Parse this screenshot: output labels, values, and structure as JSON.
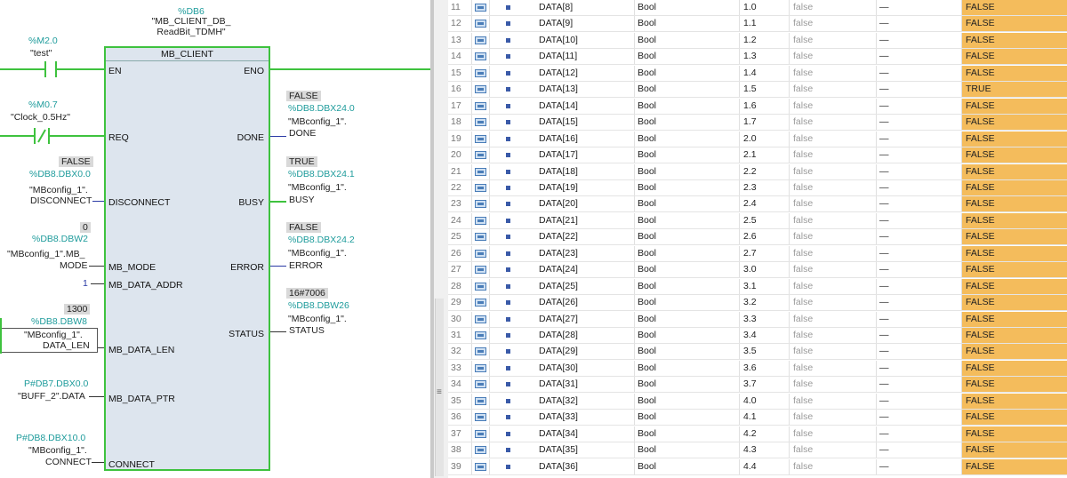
{
  "fb": {
    "instance_addr": "%DB6",
    "instance_name_1": "\"MB_CLIENT_DB_",
    "instance_name_2": "ReadBit_TDMH\"",
    "title": "MB_CLIENT",
    "pin_en": "EN",
    "pin_eno": "ENO",
    "pin_req": "REQ",
    "pin_disconnect": "DISCONNECT",
    "pin_mb_mode": "MB_MODE",
    "pin_mb_data_addr": "MB_DATA_ADDR",
    "pin_mb_data_len": "MB_DATA_LEN",
    "pin_mb_data_ptr": "MB_DATA_PTR",
    "pin_connect": "CONNECT",
    "pin_done": "DONE",
    "pin_busy": "BUSY",
    "pin_error": "ERROR",
    "pin_status": "STATUS"
  },
  "inputs": {
    "en_addr": "%M2.0",
    "en_tag": "\"test\"",
    "req_addr": "%M0.7",
    "req_tag": "\"Clock_0.5Hz\"",
    "disc_val": "FALSE",
    "disc_addr": "%DB8.DBX0.0",
    "disc_tag_1": "\"MBconfig_1\".",
    "disc_tag_2": "DISCONNECT",
    "mode_val": "0",
    "mode_addr": "%DB8.DBW2",
    "mode_tag_1": "\"MBconfig_1\".MB_",
    "mode_tag_2": "MODE",
    "addr_val": "1",
    "len_val": "1300",
    "len_addr": "%DB8.DBW8",
    "len_tag_1": "\"MBconfig_1\".",
    "len_tag_2": "DATA_LEN",
    "ptr_addr": "P#DB7.DBX0.0",
    "ptr_tag": "\"BUFF_2\".DATA",
    "conn_addr": "P#DB8.DBX10.0",
    "conn_tag_1": "\"MBconfig_1\".",
    "conn_tag_2": "CONNECT"
  },
  "outputs": {
    "done_val": "FALSE",
    "done_addr": "%DB8.DBX24.0",
    "done_tag_1": "\"MBconfig_1\".",
    "done_tag_2": "DONE",
    "busy_val": "TRUE",
    "busy_addr": "%DB8.DBX24.1",
    "busy_tag_1": "\"MBconfig_1\".",
    "busy_tag_2": "BUSY",
    "error_val": "FALSE",
    "error_addr": "%DB8.DBX24.2",
    "error_tag_1": "\"MBconfig_1\".",
    "error_tag_2": "ERROR",
    "status_val": "16#7006",
    "status_addr": "%DB8.DBW26",
    "status_tag_1": "\"MBconfig_1\".",
    "status_tag_2": "STATUS"
  },
  "table": {
    "rows": [
      {
        "num": "11",
        "name": "DATA[8]",
        "type": "Bool",
        "offset": "1.0",
        "start": "false",
        "retain": "—",
        "monitor": "FALSE"
      },
      {
        "num": "12",
        "name": "DATA[9]",
        "type": "Bool",
        "offset": "1.1",
        "start": "false",
        "retain": "—",
        "monitor": "FALSE"
      },
      {
        "num": "13",
        "name": "DATA[10]",
        "type": "Bool",
        "offset": "1.2",
        "start": "false",
        "retain": "—",
        "monitor": "FALSE"
      },
      {
        "num": "14",
        "name": "DATA[11]",
        "type": "Bool",
        "offset": "1.3",
        "start": "false",
        "retain": "—",
        "monitor": "FALSE"
      },
      {
        "num": "15",
        "name": "DATA[12]",
        "type": "Bool",
        "offset": "1.4",
        "start": "false",
        "retain": "—",
        "monitor": "FALSE"
      },
      {
        "num": "16",
        "name": "DATA[13]",
        "type": "Bool",
        "offset": "1.5",
        "start": "false",
        "retain": "—",
        "monitor": "TRUE"
      },
      {
        "num": "17",
        "name": "DATA[14]",
        "type": "Bool",
        "offset": "1.6",
        "start": "false",
        "retain": "—",
        "monitor": "FALSE"
      },
      {
        "num": "18",
        "name": "DATA[15]",
        "type": "Bool",
        "offset": "1.7",
        "start": "false",
        "retain": "—",
        "monitor": "FALSE"
      },
      {
        "num": "19",
        "name": "DATA[16]",
        "type": "Bool",
        "offset": "2.0",
        "start": "false",
        "retain": "—",
        "monitor": "FALSE"
      },
      {
        "num": "20",
        "name": "DATA[17]",
        "type": "Bool",
        "offset": "2.1",
        "start": "false",
        "retain": "—",
        "monitor": "FALSE"
      },
      {
        "num": "21",
        "name": "DATA[18]",
        "type": "Bool",
        "offset": "2.2",
        "start": "false",
        "retain": "—",
        "monitor": "FALSE"
      },
      {
        "num": "22",
        "name": "DATA[19]",
        "type": "Bool",
        "offset": "2.3",
        "start": "false",
        "retain": "—",
        "monitor": "FALSE"
      },
      {
        "num": "23",
        "name": "DATA[20]",
        "type": "Bool",
        "offset": "2.4",
        "start": "false",
        "retain": "—",
        "monitor": "FALSE"
      },
      {
        "num": "24",
        "name": "DATA[21]",
        "type": "Bool",
        "offset": "2.5",
        "start": "false",
        "retain": "—",
        "monitor": "FALSE"
      },
      {
        "num": "25",
        "name": "DATA[22]",
        "type": "Bool",
        "offset": "2.6",
        "start": "false",
        "retain": "—",
        "monitor": "FALSE"
      },
      {
        "num": "26",
        "name": "DATA[23]",
        "type": "Bool",
        "offset": "2.7",
        "start": "false",
        "retain": "—",
        "monitor": "FALSE"
      },
      {
        "num": "27",
        "name": "DATA[24]",
        "type": "Bool",
        "offset": "3.0",
        "start": "false",
        "retain": "—",
        "monitor": "FALSE"
      },
      {
        "num": "28",
        "name": "DATA[25]",
        "type": "Bool",
        "offset": "3.1",
        "start": "false",
        "retain": "—",
        "monitor": "FALSE"
      },
      {
        "num": "29",
        "name": "DATA[26]",
        "type": "Bool",
        "offset": "3.2",
        "start": "false",
        "retain": "—",
        "monitor": "FALSE"
      },
      {
        "num": "30",
        "name": "DATA[27]",
        "type": "Bool",
        "offset": "3.3",
        "start": "false",
        "retain": "—",
        "monitor": "FALSE"
      },
      {
        "num": "31",
        "name": "DATA[28]",
        "type": "Bool",
        "offset": "3.4",
        "start": "false",
        "retain": "—",
        "monitor": "FALSE"
      },
      {
        "num": "32",
        "name": "DATA[29]",
        "type": "Bool",
        "offset": "3.5",
        "start": "false",
        "retain": "—",
        "monitor": "FALSE"
      },
      {
        "num": "33",
        "name": "DATA[30]",
        "type": "Bool",
        "offset": "3.6",
        "start": "false",
        "retain": "—",
        "monitor": "FALSE"
      },
      {
        "num": "34",
        "name": "DATA[31]",
        "type": "Bool",
        "offset": "3.7",
        "start": "false",
        "retain": "—",
        "monitor": "FALSE"
      },
      {
        "num": "35",
        "name": "DATA[32]",
        "type": "Bool",
        "offset": "4.0",
        "start": "false",
        "retain": "—",
        "monitor": "FALSE"
      },
      {
        "num": "36",
        "name": "DATA[33]",
        "type": "Bool",
        "offset": "4.1",
        "start": "false",
        "retain": "—",
        "monitor": "FALSE"
      },
      {
        "num": "37",
        "name": "DATA[34]",
        "type": "Bool",
        "offset": "4.2",
        "start": "false",
        "retain": "—",
        "monitor": "FALSE"
      },
      {
        "num": "38",
        "name": "DATA[35]",
        "type": "Bool",
        "offset": "4.3",
        "start": "false",
        "retain": "—",
        "monitor": "FALSE"
      },
      {
        "num": "39",
        "name": "DATA[36]",
        "type": "Bool",
        "offset": "4.4",
        "start": "false",
        "retain": "—",
        "monitor": "FALSE"
      }
    ]
  },
  "colors": {
    "wire_active": "#3ec23e",
    "address_teal": "#1f9c9c",
    "monitor_highlight": "#f4bc5c",
    "block_fill": "#dde5ee"
  }
}
